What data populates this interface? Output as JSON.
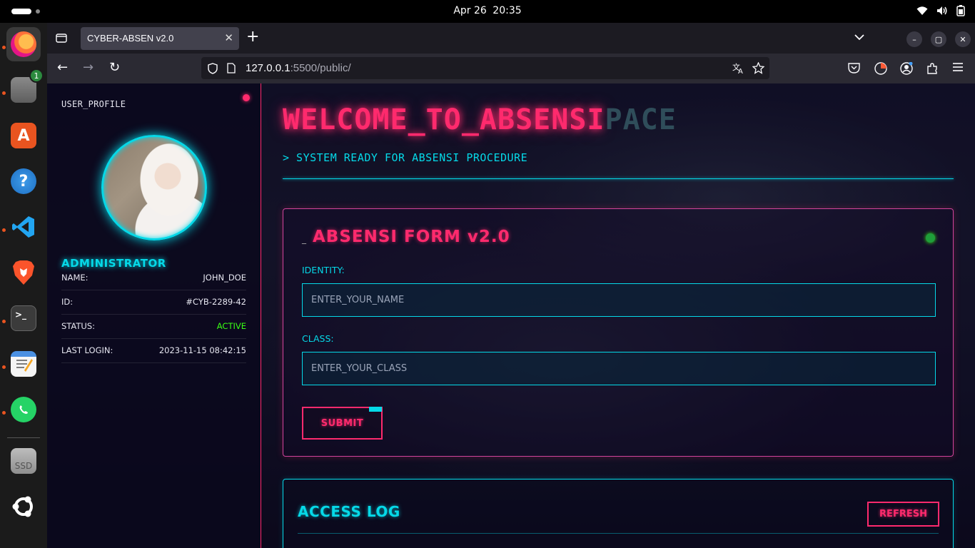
{
  "system": {
    "date": "Apr 26",
    "time": "20:35"
  },
  "dock": {
    "items": [
      {
        "name": "firefox",
        "icon": "firefox-icon"
      },
      {
        "name": "files",
        "icon": "files-icon",
        "badge": "1"
      },
      {
        "name": "app-center",
        "icon": "app-center-icon"
      },
      {
        "name": "help",
        "icon": "help-icon"
      },
      {
        "name": "vscode",
        "icon": "vscode-icon"
      },
      {
        "name": "brave",
        "icon": "brave-icon"
      },
      {
        "name": "terminal",
        "icon": "terminal-icon"
      },
      {
        "name": "text-editor",
        "icon": "text-editor-icon"
      },
      {
        "name": "whatsapp",
        "icon": "whatsapp-icon"
      },
      {
        "name": "ssd",
        "icon": "drive-icon",
        "label": "SSD"
      },
      {
        "name": "ubuntu",
        "icon": "ubuntu-icon"
      }
    ]
  },
  "browser": {
    "tab_title": "CYBER-ABSEN v2.0",
    "url_host": "127.0.0.1",
    "url_rest": ":5500/public/"
  },
  "sidebar": {
    "heading": "USER_PROFILE",
    "role": "ADMINISTRATOR",
    "rows": [
      {
        "key": "NAME:",
        "value": "JOHN_DOE"
      },
      {
        "key": "ID:",
        "value": "#CYB-2289-42"
      },
      {
        "key": "STATUS:",
        "value": "ACTIVE"
      },
      {
        "key": "LAST LOGIN:",
        "value": "2023-11-15 08:42:15"
      }
    ]
  },
  "main": {
    "title": "WELCOME_TO_ABSENSI",
    "title_ghost": "PACE",
    "subtitle": "> SYSTEM READY FOR ABSENSI PROCEDURE"
  },
  "form": {
    "cursor": "_",
    "title": "ABSENSI FORM v2.0",
    "identity_label": "IDENTITY:",
    "identity_placeholder": "ENTER_YOUR_NAME",
    "class_label": "CLASS:",
    "class_placeholder": "ENTER_YOUR_CLASS",
    "submit_label": "SUBMIT"
  },
  "log": {
    "title": "ACCESS LOG",
    "refresh_label": "REFRESH"
  },
  "colors": {
    "neon_pink": "#ff2a6d",
    "neon_cyan": "#05d9e8",
    "status_green": "#39ff14"
  }
}
